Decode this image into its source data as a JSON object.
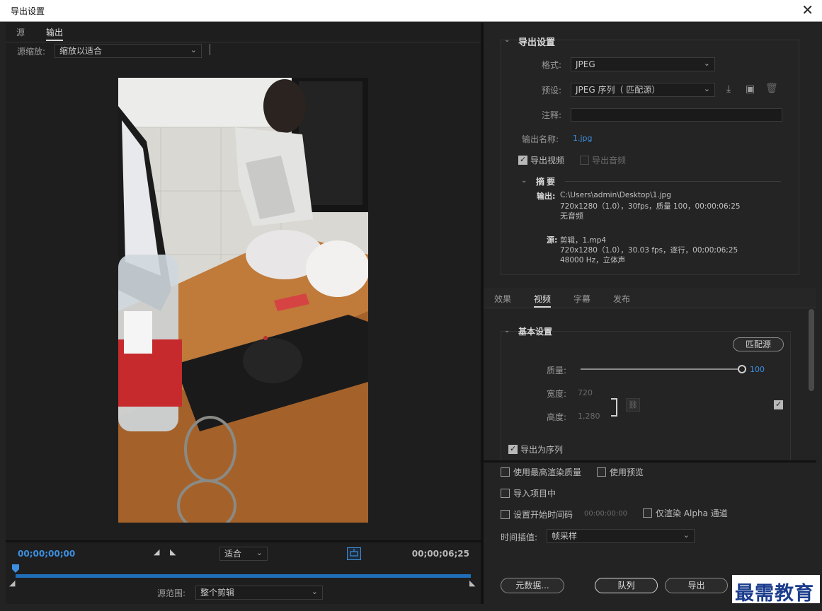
{
  "window": {
    "title": "导出设置",
    "close_glyph": "✕"
  },
  "left": {
    "tabs": [
      "源",
      "输出"
    ],
    "active_tab": "输出",
    "scale_label": "源缩放:",
    "scale_value": "缩放以适合",
    "timeline": {
      "current_time": "00;00;00;00",
      "end_time": "00;00;06;25",
      "fit_label": "适合",
      "range_label": "源范围:",
      "range_value": "整个剪辑",
      "progress": 1.0
    }
  },
  "right": {
    "export_settings": {
      "heading": "导出设置",
      "format_label": "格式:",
      "format_value": "JPEG",
      "preset_label": "预设:",
      "preset_value": "JPEG 序列（ 匹配源）",
      "comment_label": "注释:",
      "comment_value": "",
      "output_name_label": "输出名称:",
      "output_name_value": "1.jpg",
      "export_video_label": "导出视频",
      "export_video_checked": true,
      "export_audio_label": "导出音频",
      "export_audio_checked": false
    },
    "summary": {
      "heading": "摘要",
      "output_label": "输出:",
      "output_lines": [
        "C:\\Users\\admin\\Desktop\\1.jpg",
        "720x1280（1.0），30fps，质量 100，00:00:06:25",
        "无音频"
      ],
      "source_label": "源:",
      "source_lines": [
        "剪辑，1.mp4",
        "720x1280（1.0），30.03 fps，逐行，00;00;06;25",
        "48000 Hz，立体声"
      ]
    },
    "tabs": [
      "效果",
      "视频",
      "字幕",
      "发布"
    ],
    "active_tab": "视频",
    "basic": {
      "heading": "基本设置",
      "match_source": "匹配源",
      "quality_label": "质量:",
      "quality_value": "100",
      "quality_level": 100,
      "width_label": "宽度:",
      "width_value": "720",
      "height_label": "高度:",
      "height_value": "1,280",
      "export_sequence_label": "导出为序列",
      "export_sequence_checked": true
    },
    "options": {
      "max_render_quality": "使用最高渲染质量",
      "use_preview": "使用预览",
      "import_into_project": "导入项目中",
      "set_start_timecode": "设置开始时间码",
      "start_timecode_value": "00:00:00:00",
      "render_alpha_only": "仅渲染 Alpha 通道",
      "time_interp_label": "时间插值:",
      "time_interp_value": "帧采样"
    },
    "buttons": {
      "metadata": "元数据...",
      "queue": "队列",
      "export": "导出"
    }
  },
  "watermark": "最需教育",
  "colors": {
    "accent": "#3d8fe0",
    "timeline_bar": "#1f6fb8"
  }
}
